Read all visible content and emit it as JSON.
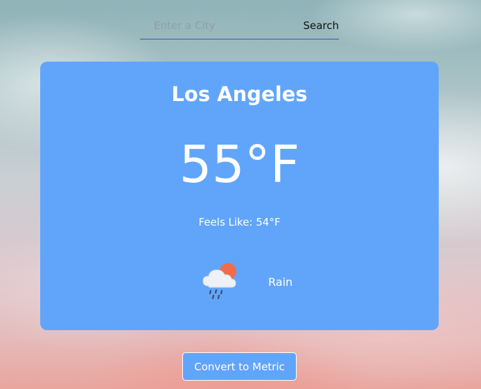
{
  "search": {
    "placeholder": "Enter a City",
    "button_label": "Search"
  },
  "weather": {
    "city": "Los Angeles",
    "temperature": "55°F",
    "feels_like": "Feels Like: 54°F",
    "condition": "Rain",
    "condition_icon": "rain-cloud-sun-icon"
  },
  "actions": {
    "convert_label": "Convert to Metric"
  },
  "colors": {
    "card_background": "#61a5fb",
    "text": "#ffffff",
    "search_underline": "#3f51b5",
    "sun": "#f26b4a",
    "cloud": "#eef1f6",
    "rain": "#3d4a66"
  }
}
